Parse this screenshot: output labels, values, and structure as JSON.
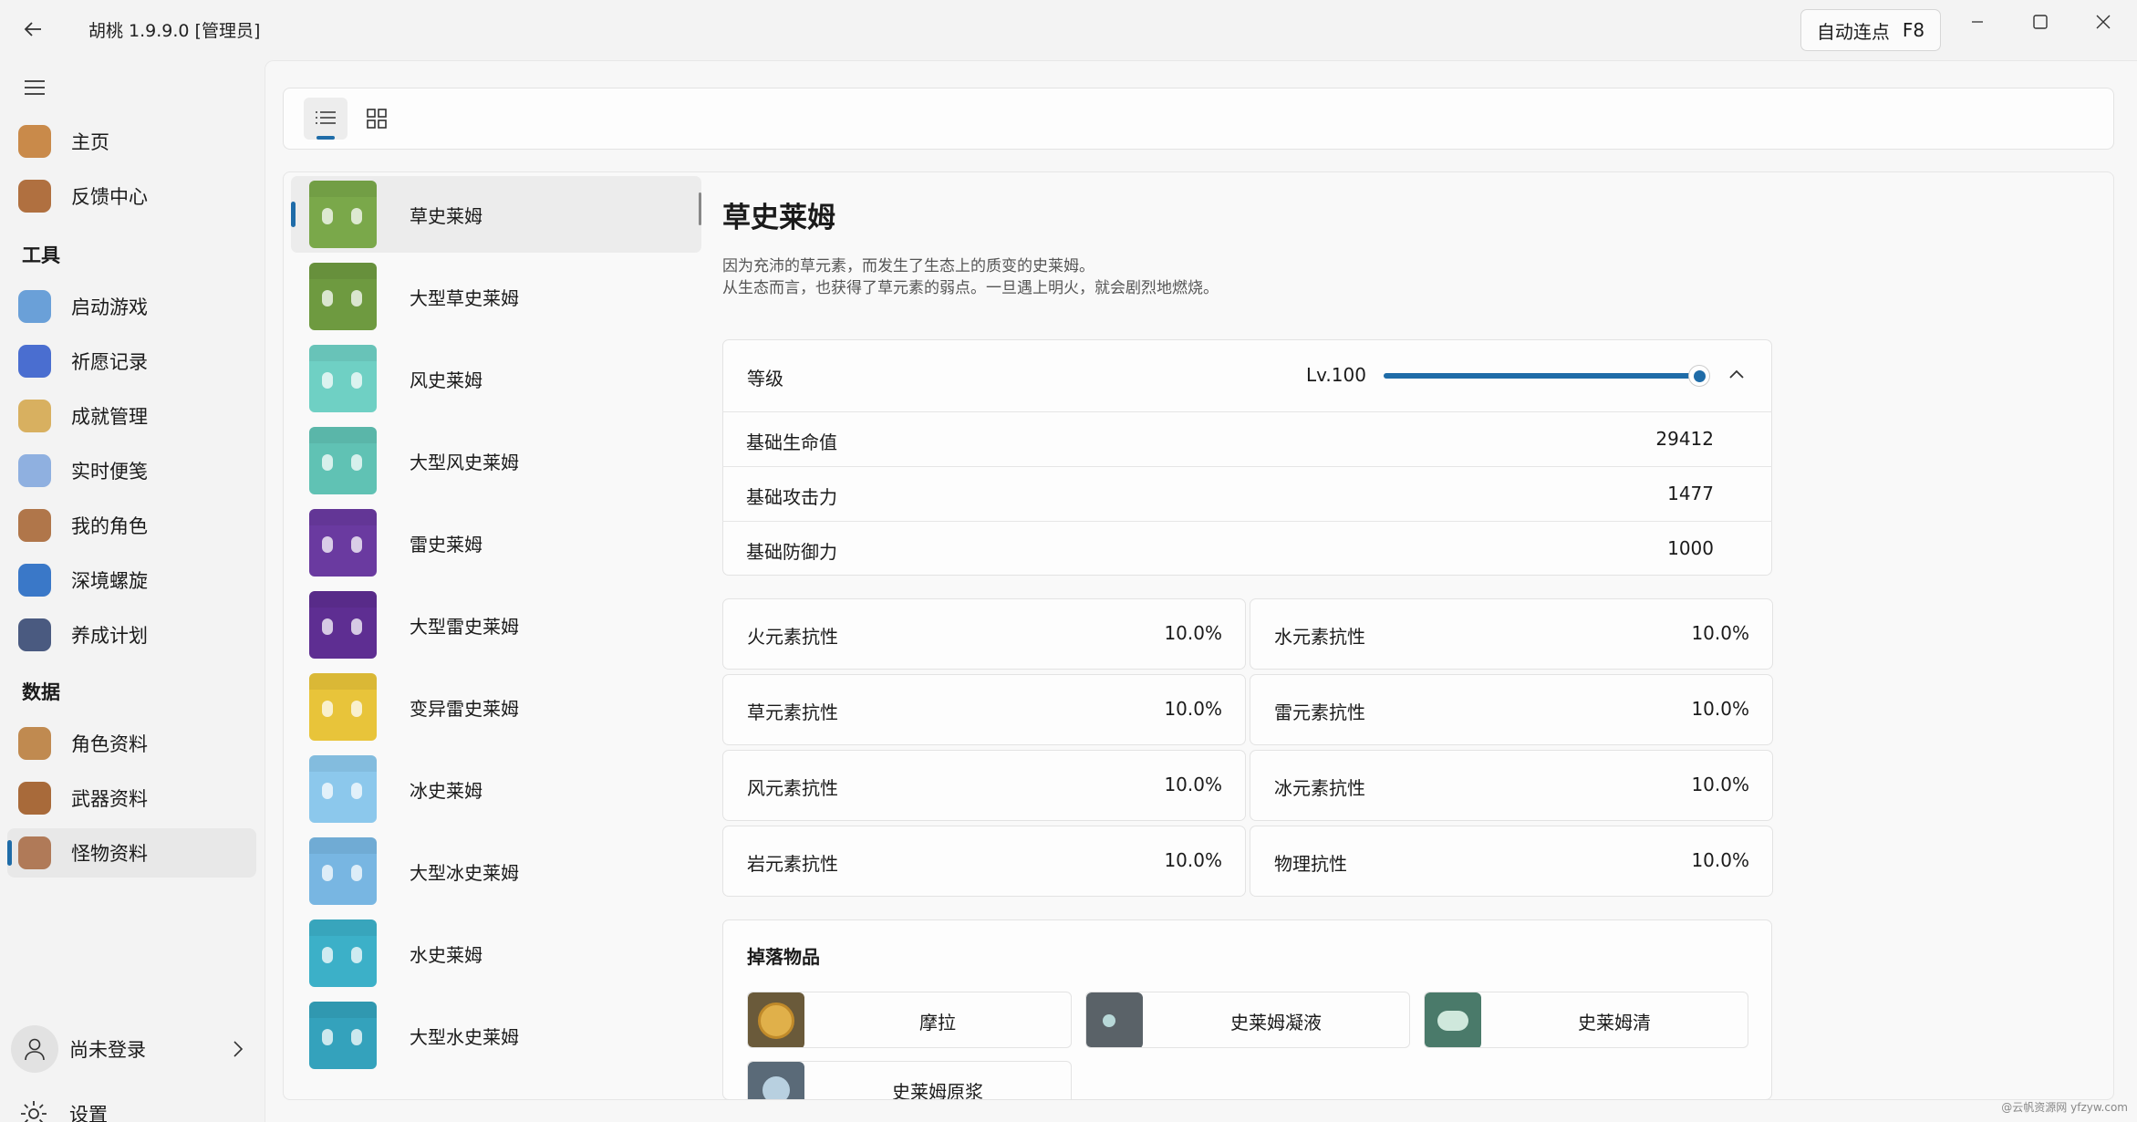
{
  "app": {
    "title": "胡桃 1.9.9.0 [管理员]"
  },
  "auto_click": {
    "label": "自动连点",
    "key": "F8"
  },
  "nav": {
    "items": [
      {
        "label": "主页",
        "icon": "home-icon",
        "color": "#c98a4a"
      },
      {
        "label": "反馈中心",
        "icon": "feedback-icon",
        "color": "#b07040"
      }
    ],
    "section_tools": "工具",
    "tools": [
      {
        "label": "启动游戏",
        "icon": "launch-game-icon",
        "color": "#6aa0d8"
      },
      {
        "label": "祈愿记录",
        "icon": "wish-history-icon",
        "color": "#4a6ed0"
      },
      {
        "label": "成就管理",
        "icon": "achievement-icon",
        "color": "#d8b060"
      },
      {
        "label": "实时便笺",
        "icon": "realtime-notes-icon",
        "color": "#8fb0e0"
      },
      {
        "label": "我的角色",
        "icon": "my-characters-icon",
        "color": "#b0764a"
      },
      {
        "label": "深境螺旋",
        "icon": "spiral-abyss-icon",
        "color": "#3a78c8"
      },
      {
        "label": "养成计划",
        "icon": "cultivation-icon",
        "color": "#4a5a80"
      }
    ],
    "section_data": "数据",
    "data": [
      {
        "label": "角色资料",
        "icon": "character-wiki-icon",
        "color": "#c08a50"
      },
      {
        "label": "武器资料",
        "icon": "weapon-wiki-icon",
        "color": "#a86a3a"
      },
      {
        "label": "怪物资料",
        "icon": "monster-wiki-icon",
        "color": "#b07a58"
      }
    ],
    "user": "尚未登录",
    "settings": "设置"
  },
  "monsters": [
    {
      "name": "草史莱姆",
      "color": "#7aa84a"
    },
    {
      "name": "大型草史莱姆",
      "color": "#6e9a40"
    },
    {
      "name": "风史莱姆",
      "color": "#6fd0c4"
    },
    {
      "name": "大型风史莱姆",
      "color": "#60c2b4"
    },
    {
      "name": "雷史莱姆",
      "color": "#6a3aa0"
    },
    {
      "name": "大型雷史莱姆",
      "color": "#5e2e92"
    },
    {
      "name": "变异雷史莱姆",
      "color": "#e8c43a"
    },
    {
      "name": "冰史莱姆",
      "color": "#8cc8ec"
    },
    {
      "name": "大型冰史莱姆",
      "color": "#78b6e2"
    },
    {
      "name": "水史莱姆",
      "color": "#3cb0c8"
    },
    {
      "name": "大型水史莱姆",
      "color": "#34a2bc"
    }
  ],
  "detail": {
    "title": "草史莱姆",
    "desc1": "因为充沛的草元素，而发生了生态上的质变的史莱姆。",
    "desc2": "从生态而言，也获得了草元素的弱点。一旦遇上明火，就会剧烈地燃烧。",
    "level_label": "等级",
    "level_value": "Lv.100",
    "level_fraction": 1.0,
    "stats": [
      {
        "k": "基础生命值",
        "v": "29412"
      },
      {
        "k": "基础攻击力",
        "v": "1477"
      },
      {
        "k": "基础防御力",
        "v": "1000"
      }
    ],
    "resist": [
      {
        "k": "火元素抗性",
        "v": "10.0%"
      },
      {
        "k": "水元素抗性",
        "v": "10.0%"
      },
      {
        "k": "草元素抗性",
        "v": "10.0%"
      },
      {
        "k": "雷元素抗性",
        "v": "10.0%"
      },
      {
        "k": "风元素抗性",
        "v": "10.0%"
      },
      {
        "k": "冰元素抗性",
        "v": "10.0%"
      },
      {
        "k": "岩元素抗性",
        "v": "10.0%"
      },
      {
        "k": "物理抗性",
        "v": "10.0%"
      }
    ],
    "drops_title": "掉落物品",
    "drops": [
      {
        "name": "摩拉",
        "color": "#6a5a3a"
      },
      {
        "name": "史莱姆凝液",
        "color": "#5a6268"
      },
      {
        "name": "史莱姆清",
        "color": "#4a7a6a"
      },
      {
        "name": "史莱姆原浆",
        "color": "#5a6a78"
      }
    ]
  },
  "watermark": "@云帆资源网 yfzyw.com",
  "accent": "#1f6ca8"
}
